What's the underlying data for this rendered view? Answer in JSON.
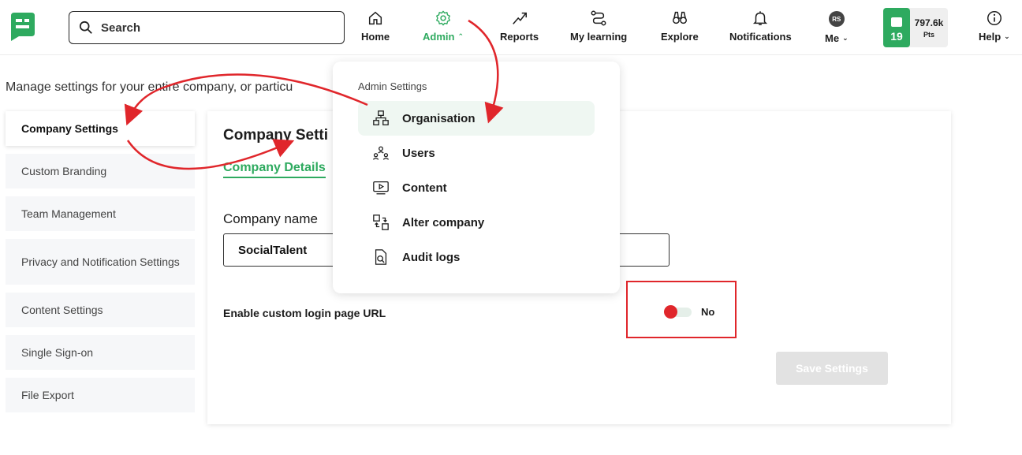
{
  "header": {
    "search_placeholder": "Search",
    "nav": [
      {
        "label": "Home",
        "icon": "home-icon"
      },
      {
        "label": "Admin",
        "icon": "gear-icon"
      },
      {
        "label": "Reports",
        "icon": "trend-up-icon"
      },
      {
        "label": "My learning",
        "icon": "path-icon"
      },
      {
        "label": "Explore",
        "icon": "binoculars-icon"
      },
      {
        "label": "Notifications",
        "icon": "bell-icon"
      },
      {
        "label": "Me",
        "icon": "avatar"
      },
      {
        "label": "Help",
        "icon": "info-icon"
      }
    ],
    "avatar_initials": "RS",
    "points": {
      "level": "19",
      "value": "797.6k",
      "unit": "Pts"
    },
    "accent": "#2eaa5f"
  },
  "manage_text": "Manage settings for your entire company, or particu",
  "sidebar": {
    "items": [
      {
        "label": "Company Settings",
        "active": true
      },
      {
        "label": "Custom Branding"
      },
      {
        "label": "Team Management"
      },
      {
        "label": "Privacy and Notification Settings"
      },
      {
        "label": "Content Settings"
      },
      {
        "label": "Single Sign-on"
      },
      {
        "label": "File Export"
      }
    ]
  },
  "panel": {
    "title": "Company Setti",
    "tab": "Company Details",
    "company_name_label": "Company name",
    "company_name_value": "SocialTalent",
    "toggle_label": "Enable custom login page URL",
    "toggle_state": "No",
    "save_label": "Save Settings"
  },
  "dropdown": {
    "title": "Admin Settings",
    "items": [
      {
        "label": "Organisation",
        "icon": "hierarchy-icon",
        "active": true
      },
      {
        "label": "Users",
        "icon": "users-icon"
      },
      {
        "label": "Content",
        "icon": "video-icon"
      },
      {
        "label": "Alter company",
        "icon": "switch-icon"
      },
      {
        "label": "Audit logs",
        "icon": "search-document-icon"
      }
    ]
  },
  "colors": {
    "annotation": "#e0262b"
  }
}
